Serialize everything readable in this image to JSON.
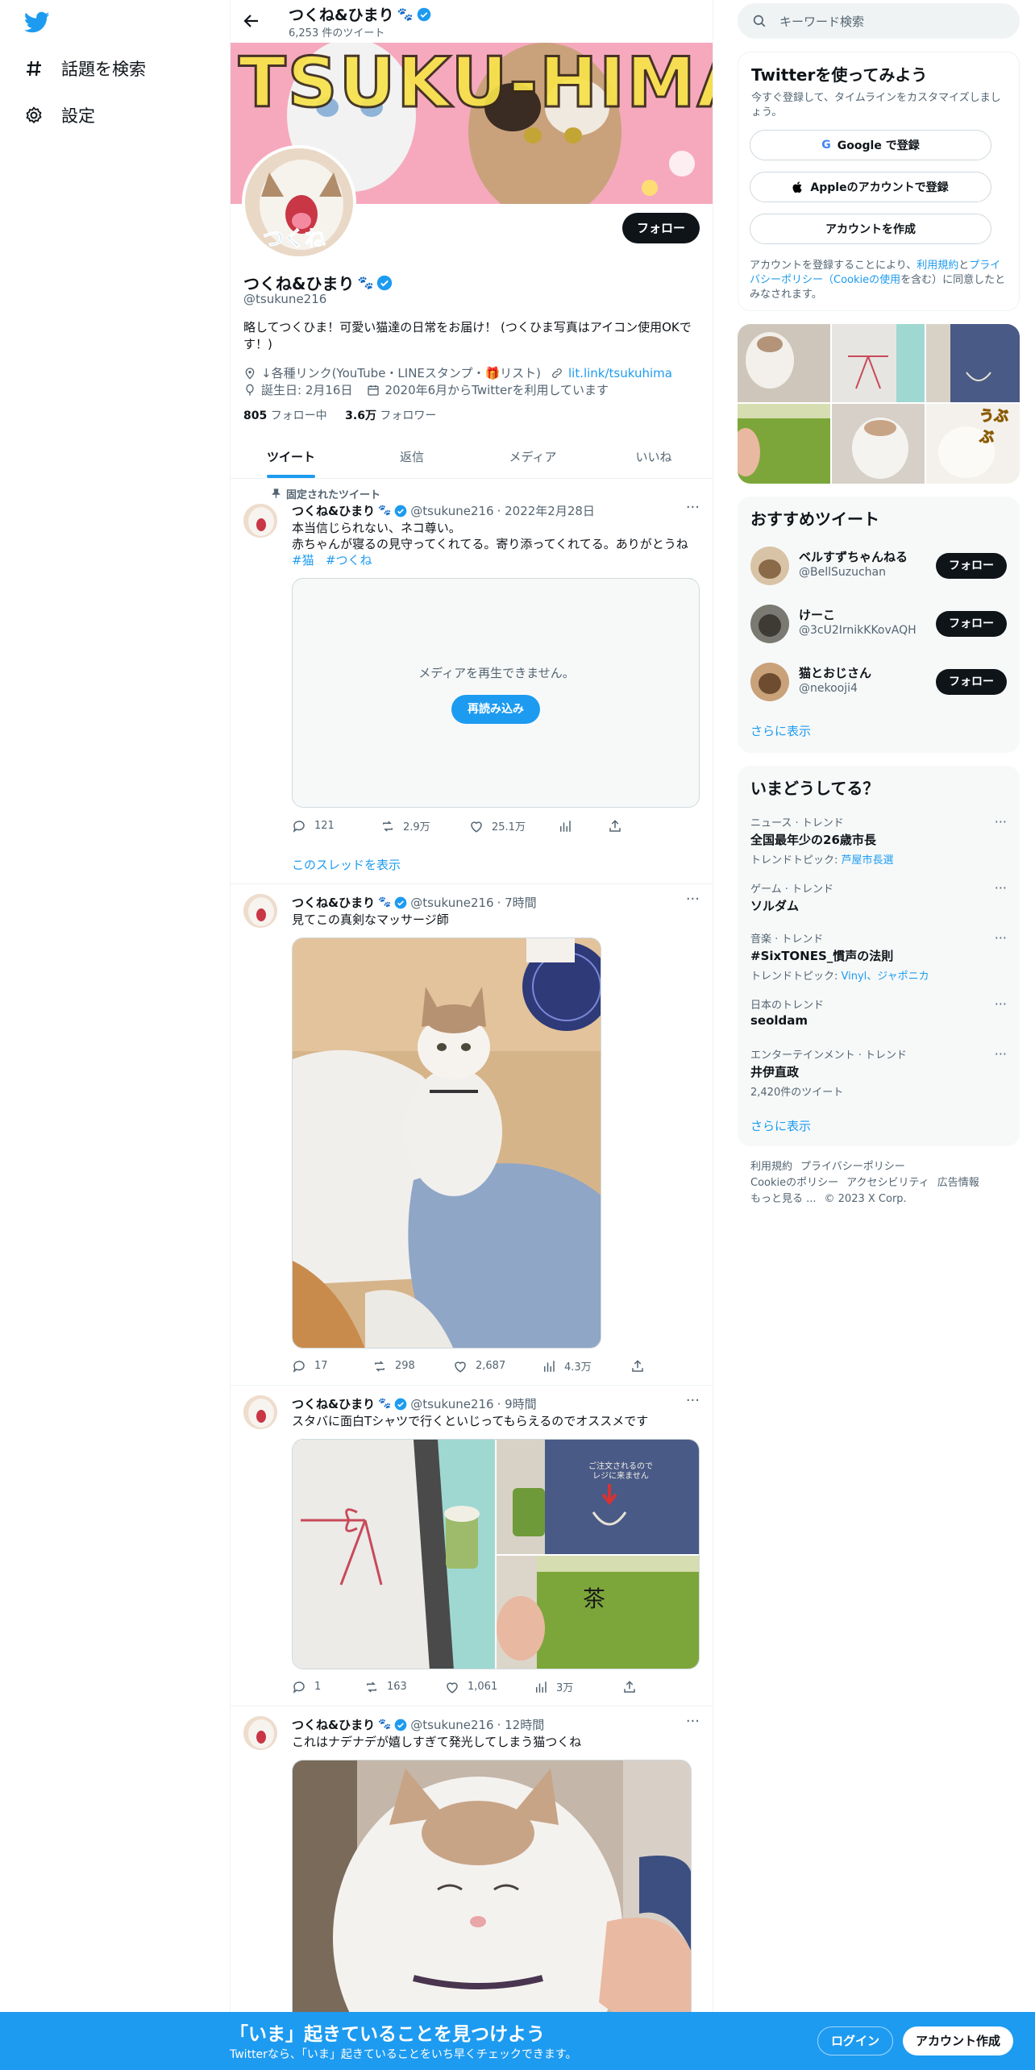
{
  "nav": {
    "explore_label": "話題を検索",
    "settings_label": "設定"
  },
  "header": {
    "name": "つくね&ひまり",
    "tweet_count": "6,253 件のツイート"
  },
  "banner": {
    "text": "TSUKU-HIMA"
  },
  "profile": {
    "avatar_text": "つくね",
    "follow_label": "フォロー",
    "name": "つくね&ひまり",
    "handle": "@tsukune216",
    "bio": "略してつくひま！可愛い猫達の日常をお届け！ (つくひま写真はアイコン使用OKです！)",
    "links_text": "↓各種リンク(YouTube・LINEスタンプ・🎁リスト)",
    "link_url_text": "lit.link/tsukuhima",
    "birthday": "誕生日: 2月16日",
    "joined": "2020年6月からTwitterを利用しています",
    "following_count": "805",
    "following_label": "フォロー中",
    "followers_count": "3.6万",
    "followers_label": "フォロワー"
  },
  "tabs": [
    "ツイート",
    "返信",
    "メディア",
    "いいね"
  ],
  "tweets": [
    {
      "pinned_label": "固定されたツイート",
      "name": "つくね&ひまり",
      "handle": "@tsukune216",
      "time": "· 2022年2月28日",
      "line1": "本当信じられない、ネコ尊い。",
      "line2": "赤ちゃんが寝るの見守ってくれてる。寄り添ってくれてる。ありがとうね",
      "hashtag1": "#猫",
      "hashtag2": "#つくね",
      "media_error": "メディアを再生できません。",
      "reload_label": "再読み込み",
      "replies": "121",
      "retweets": "2.9万",
      "likes": "25.1万",
      "thread_label": "このスレッドを表示"
    },
    {
      "name": "つくね&ひまり",
      "handle": "@tsukune216",
      "time": "· 7時間",
      "text": "見てこの真剣なマッサージ師",
      "replies": "17",
      "retweets": "298",
      "likes": "2,687",
      "views": "4.3万"
    },
    {
      "name": "つくね&ひまり",
      "handle": "@tsukune216",
      "time": "· 9時間",
      "text": "スタバに面白Tシャツで行くといじってもらえるのでオススメです",
      "replies": "1",
      "retweets": "163",
      "likes": "1,061",
      "views": "3万",
      "shirt_text_1": "ご注文されるので",
      "shirt_text_2": "レジに来ません",
      "cup_text": "茶"
    },
    {
      "name": "つくね&ひまり",
      "handle": "@tsukune216",
      "time": "· 12時間",
      "text": "これはナデナデが嬉しすぎて発光してしまう猫つくね"
    }
  ],
  "right": {
    "search_placeholder": "キーワード検索",
    "signup_title": "Twitterを使ってみよう",
    "signup_sub": "今すぐ登録して、タイムラインをカスタマイズしましょう。",
    "google_label": "Google で登録",
    "apple_label": "Appleのアカウントで登録",
    "create_label": "アカウントを作成",
    "terms_pre": "アカウントを登録することにより、",
    "terms_link1": "利用規約",
    "terms_mid": "と",
    "terms_link2": "プライバシーポリシー（Cookieの使用",
    "terms_post": "を含む）に同意したとみなされます。",
    "gallery_badge": "うぶぶ",
    "recommend_title": "おすすめツイート",
    "recommend": [
      {
        "name": "ベルすずちゃんねる",
        "handle": "@BellSuzuchan"
      },
      {
        "name": "けーこ",
        "handle": "@3cU2IrnikKKovAQH"
      },
      {
        "name": "猫とおじさん",
        "handle": "@nekooji4"
      }
    ],
    "follow_label": "フォロー",
    "show_more": "さらに表示",
    "trends_title": "いまどうしてる？",
    "trends": [
      {
        "category": "ニュース · トレンド",
        "title": "全国最年少の26歳市長",
        "sub_prefix": "トレンドトピック: ",
        "sub_link": "芦屋市長選"
      },
      {
        "category": "ゲーム · トレンド",
        "title": "ソルダム",
        "sub_prefix": "",
        "sub_link": ""
      },
      {
        "category": "音楽 · トレンド",
        "title": "#SixTONES_慣声の法則",
        "sub_prefix": "トレンドトピック: ",
        "sub_link": "Vinyl、ジャポニカ"
      },
      {
        "category": "日本のトレンド",
        "title": "seoldam",
        "sub_prefix": "",
        "sub_link": ""
      },
      {
        "category": "エンターテインメント · トレンド",
        "title": "井伊直政",
        "sub_prefix": "2,420件のツイート",
        "sub_link": ""
      }
    ],
    "footer": {
      "terms": "利用規約",
      "privacy": "プライバシーポリシー",
      "cookie": "Cookieのポリシー",
      "accessibility": "アクセシビリティ",
      "ads": "広告情報",
      "more": "もっと見る ...",
      "copyright": "© 2023 X Corp."
    }
  },
  "bottom": {
    "title": "「いま」起きていることを見つけよう",
    "sub": "Twitterなら、「いま」起きていることをいち早くチェックできます。",
    "login": "ログイン",
    "signup": "アカウント作成"
  },
  "colors": {
    "accent": "#1d9bf0",
    "text": "#0f1419",
    "muted": "#536471"
  }
}
